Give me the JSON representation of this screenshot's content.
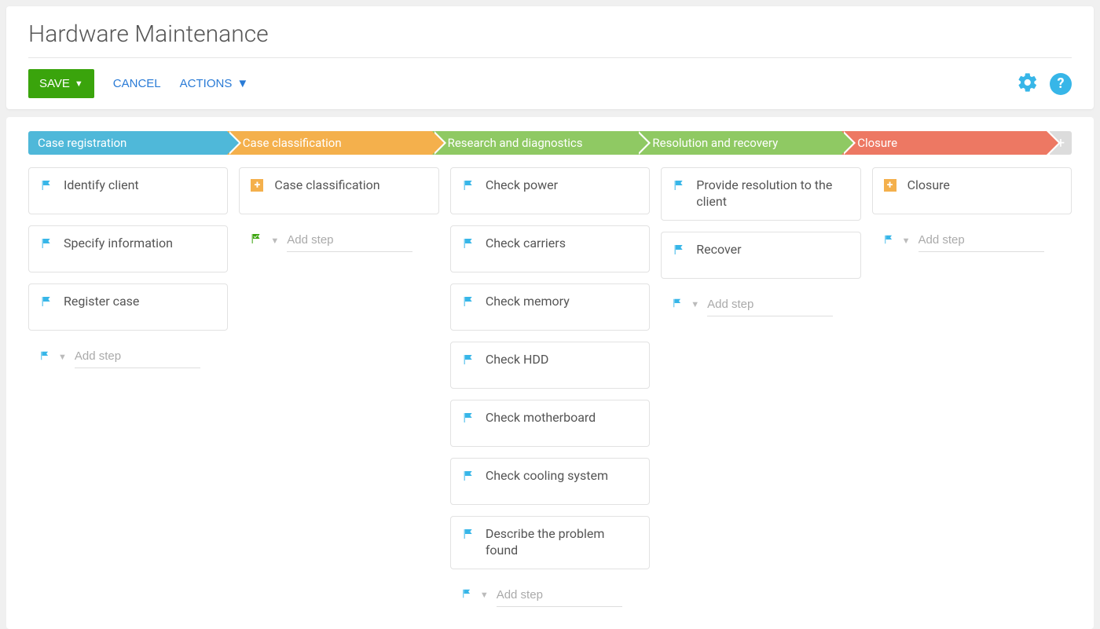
{
  "page_title": "Hardware Maintenance",
  "toolbar": {
    "save": "SAVE",
    "cancel": "CANCEL",
    "actions": "ACTIONS"
  },
  "add_step_placeholder": "Add step",
  "add_stage_label": "+",
  "stages": [
    {
      "label": "Case registration",
      "color": "stg-blue"
    },
    {
      "label": "Case classification",
      "color": "stg-orange"
    },
    {
      "label": "Research and diagnostics",
      "color": "stg-green"
    },
    {
      "label": "Resolution and recovery",
      "color": "stg-green2"
    },
    {
      "label": "Closure",
      "color": "stg-red"
    }
  ],
  "columns": [
    {
      "add_icon": "flag",
      "cards": [
        {
          "icon": "flag",
          "label": "Identify client"
        },
        {
          "icon": "flag",
          "label": "Specify information"
        },
        {
          "icon": "flag",
          "label": "Register case"
        }
      ]
    },
    {
      "add_icon": "checkflag",
      "cards": [
        {
          "icon": "plus",
          "label": "Case classification"
        }
      ]
    },
    {
      "add_icon": "flag",
      "cards": [
        {
          "icon": "flag",
          "label": "Check power"
        },
        {
          "icon": "flag",
          "label": "Check carriers"
        },
        {
          "icon": "flag",
          "label": "Check memory"
        },
        {
          "icon": "flag",
          "label": "Check HDD"
        },
        {
          "icon": "flag",
          "label": "Check motherboard"
        },
        {
          "icon": "flag",
          "label": "Check cooling system"
        },
        {
          "icon": "flag",
          "label": "Describe the problem found"
        }
      ]
    },
    {
      "add_icon": "flag",
      "cards": [
        {
          "icon": "flag",
          "label": "Provide resolution to the client"
        },
        {
          "icon": "flag",
          "label": "Recover"
        }
      ]
    },
    {
      "add_icon": "flag",
      "cards": [
        {
          "icon": "plus",
          "label": "Closure"
        }
      ]
    }
  ]
}
